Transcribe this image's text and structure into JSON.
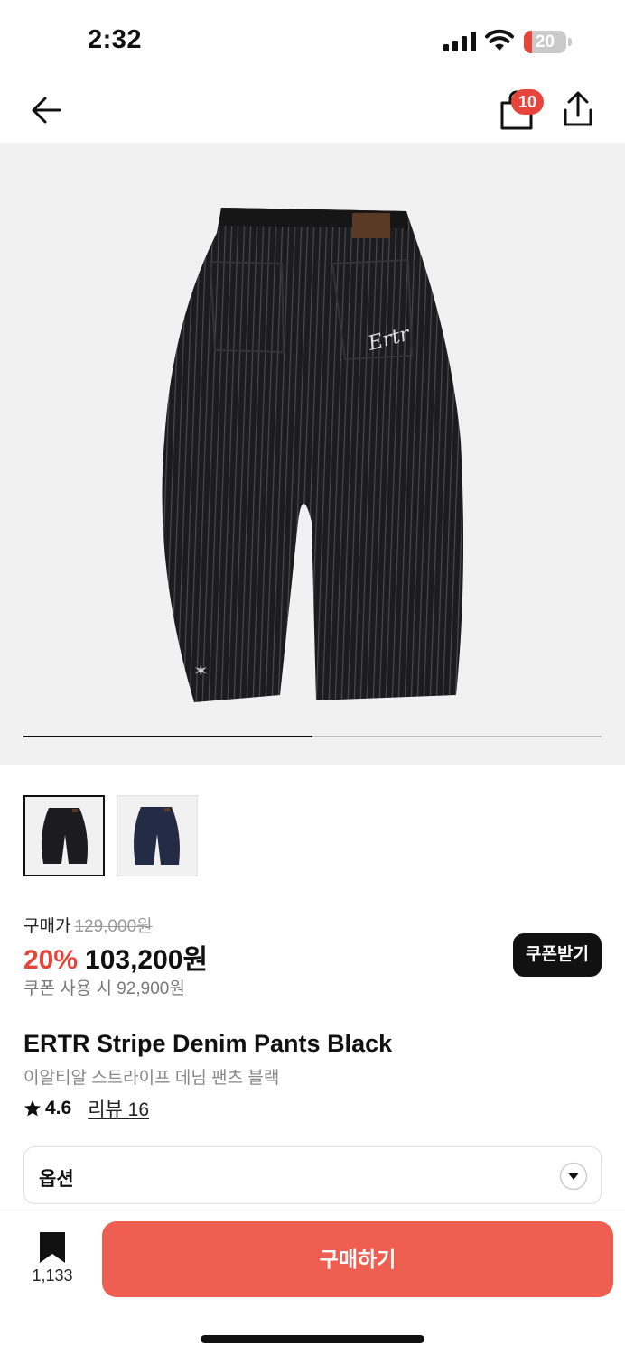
{
  "status_bar": {
    "time": "2:32",
    "battery_level": "20",
    "battery_fraction": 0.2,
    "accent_color": "#e5453b"
  },
  "nav": {
    "back_icon": "arrow-left-icon",
    "bag_icon": "shopping-bag-icon",
    "bag_count": "10",
    "share_icon": "share-icon"
  },
  "gallery": {
    "image": "black-stripe-denim-pants-back-view",
    "progress_fraction": 0.5,
    "thumbnails": [
      {
        "name": "black-pants-thumbnail",
        "selected": true
      },
      {
        "name": "navy-pants-thumbnail",
        "selected": false
      }
    ]
  },
  "price": {
    "label": "구매가",
    "original": "129,000원",
    "discount": "20%",
    "sale": "103,200원",
    "coupon_text": "쿠폰 사용 시 92,900원",
    "coupon_button": "쿠폰받기"
  },
  "product": {
    "title": "ERTR Stripe Denim Pants Black",
    "subtitle": "이알티알 스트라이프 데님 팬츠 블랙",
    "rating": "4.6",
    "review_label": "리뷰 16"
  },
  "option": {
    "label": "옵션"
  },
  "bottom_bar": {
    "bookmark_count": "1,133",
    "buy_label": "구매하기",
    "buy_color": "#ee5e51"
  }
}
